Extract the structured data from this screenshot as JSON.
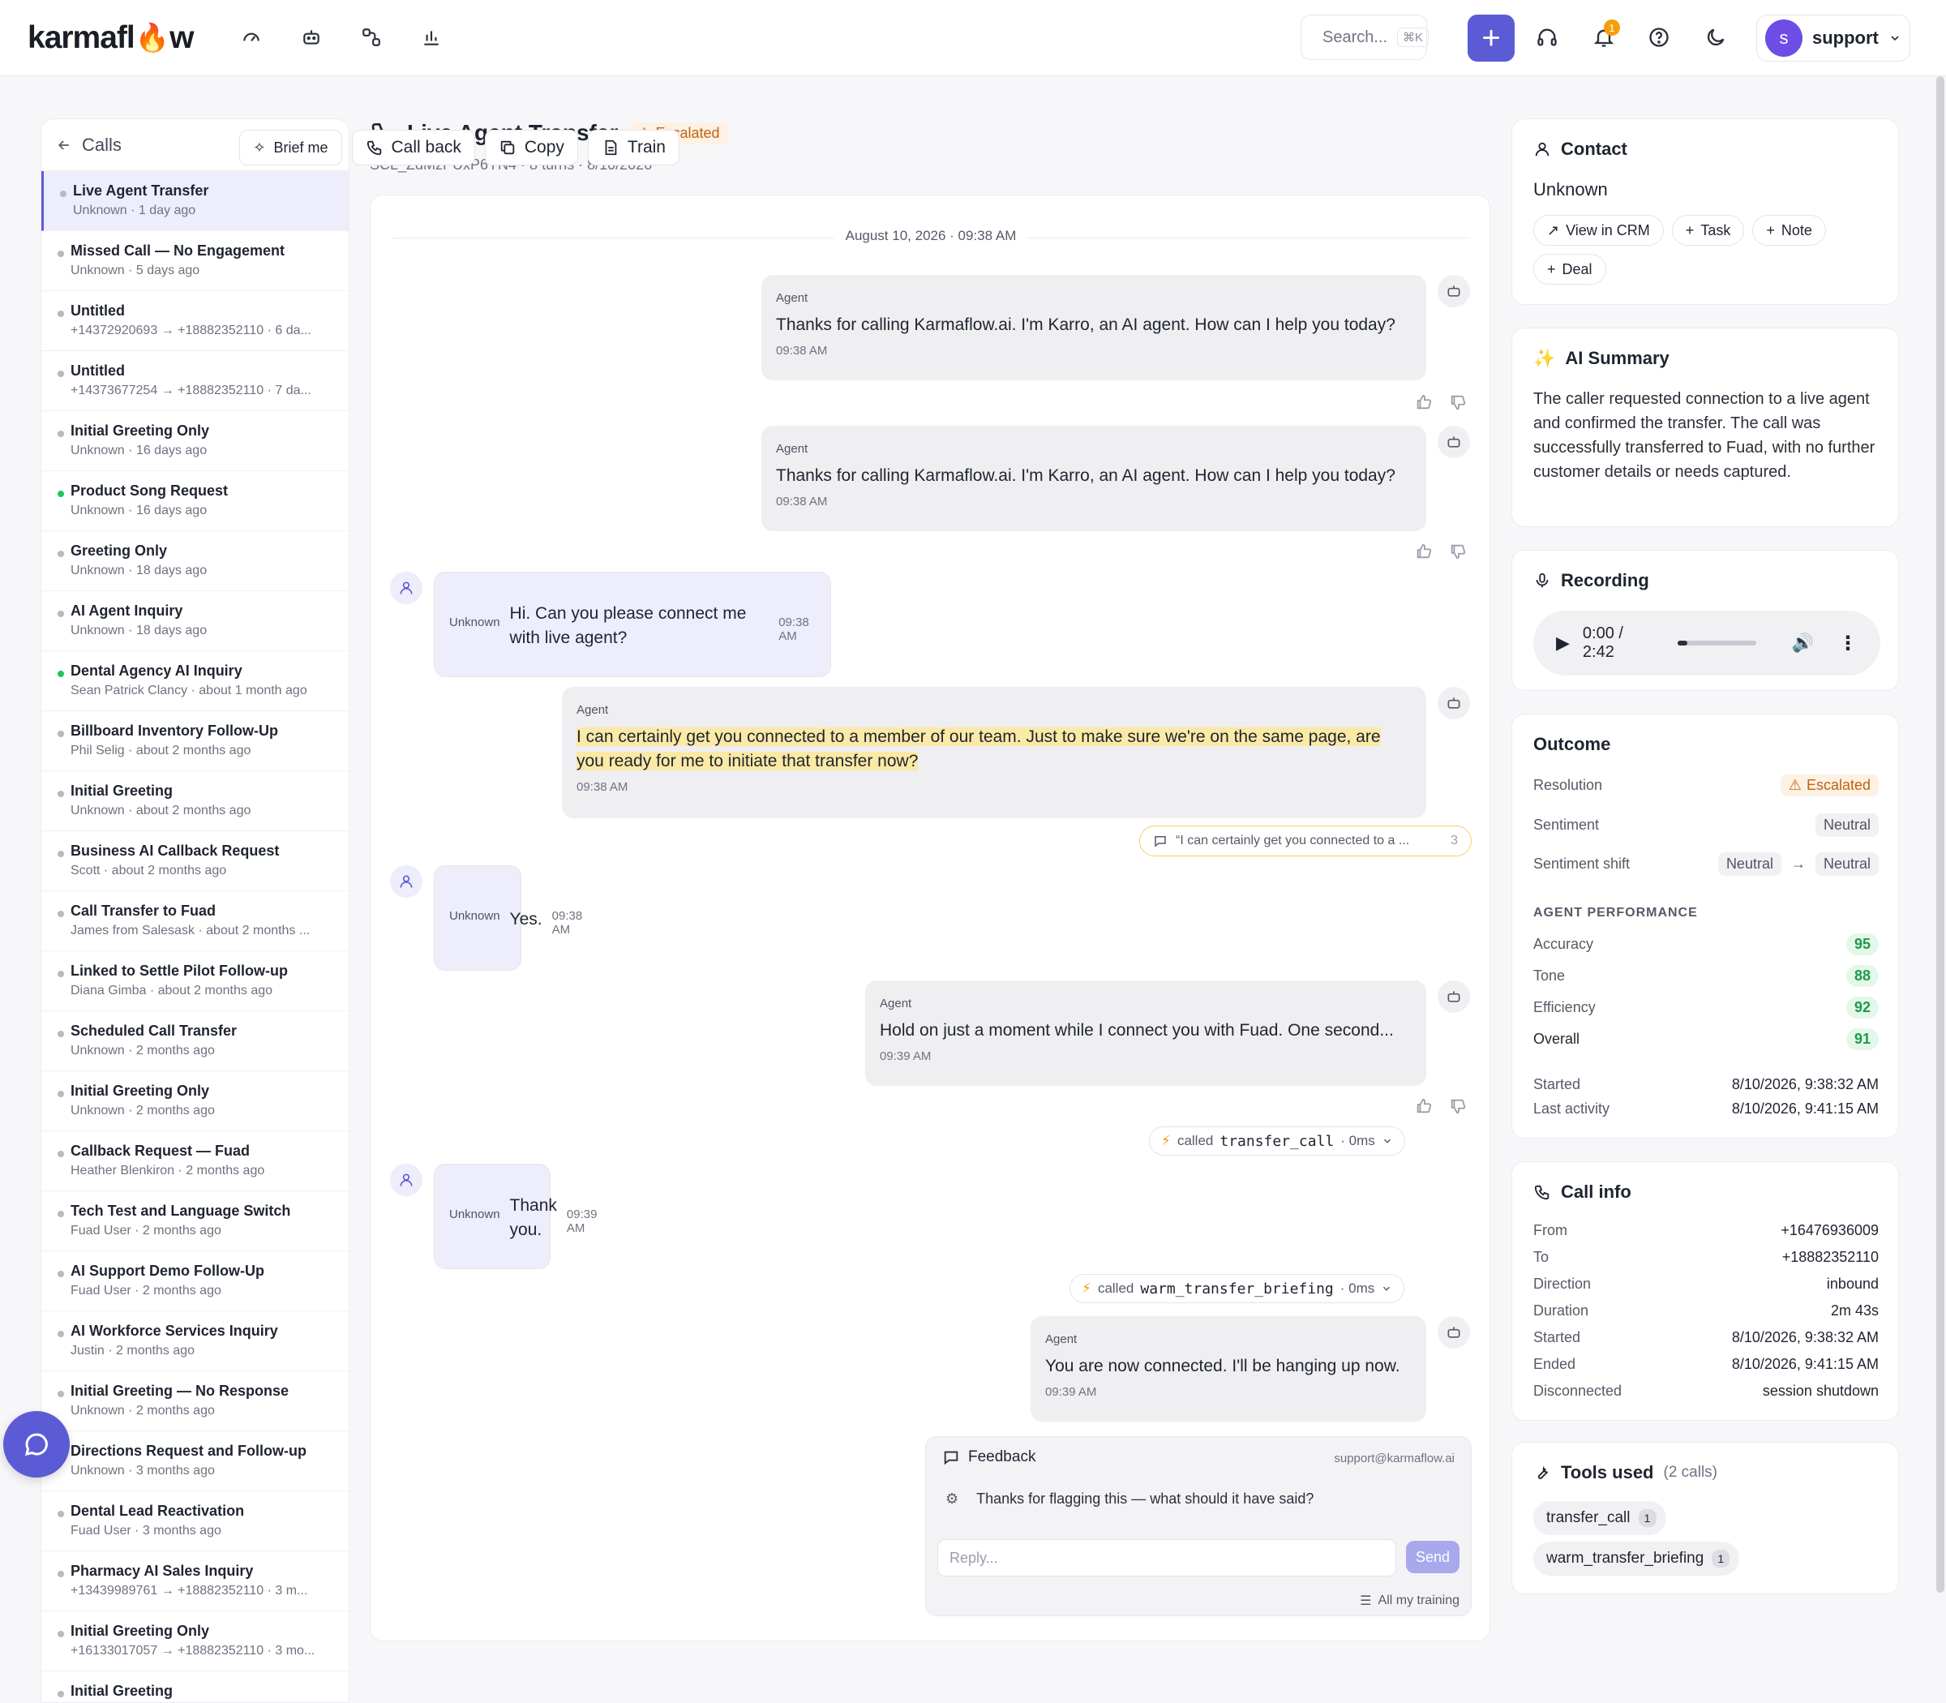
{
  "brand": {
    "logo_a": "karmafl",
    "logo_b": "w"
  },
  "topbar": {
    "nav_icons": [
      "gauge-icon",
      "bot-icon",
      "workflow-icon",
      "bar-chart-icon"
    ],
    "search_placeholder": "Search...",
    "search_kbd": "⌘K",
    "notifications_count": "1",
    "user_initial": "s",
    "user_name": "support"
  },
  "sidebar": {
    "title": "Calls",
    "items": [
      {
        "title": "Live Agent Transfer",
        "sub": "Unknown · 1 day ago",
        "dot": "gray",
        "active": true
      },
      {
        "title": "Missed Call — No Engagement",
        "sub": "Unknown · 5 days ago",
        "dot": "gray"
      },
      {
        "title": "Untitled",
        "sub": "+14372920693 → +18882352110 · 6 da...",
        "dot": "gray"
      },
      {
        "title": "Untitled",
        "sub": "+14373677254 → +18882352110 · 7 da...",
        "dot": "gray"
      },
      {
        "title": "Initial Greeting Only",
        "sub": "Unknown · 16 days ago",
        "dot": "gray"
      },
      {
        "title": "Product Song Request",
        "sub": "Unknown · 16 days ago",
        "dot": "green"
      },
      {
        "title": "Greeting Only",
        "sub": "Unknown · 18 days ago",
        "dot": "gray"
      },
      {
        "title": "AI Agent Inquiry",
        "sub": "Unknown · 18 days ago",
        "dot": "gray"
      },
      {
        "title": "Dental Agency AI Inquiry",
        "sub": "Sean Patrick Clancy · about 1 month ago",
        "dot": "green"
      },
      {
        "title": "Billboard Inventory Follow-Up",
        "sub": "Phil Selig · about 2 months ago",
        "dot": "gray"
      },
      {
        "title": "Initial Greeting",
        "sub": "Unknown · about 2 months ago",
        "dot": "gray"
      },
      {
        "title": "Business AI Callback Request",
        "sub": "Scott · about 2 months ago",
        "dot": "gray"
      },
      {
        "title": "Call Transfer to Fuad",
        "sub": "James from Salesask · about 2 months ...",
        "dot": "gray"
      },
      {
        "title": "Linked to Settle Pilot Follow-up",
        "sub": "Diana Gimba · about 2 months ago",
        "dot": "gray"
      },
      {
        "title": "Scheduled Call Transfer",
        "sub": "Unknown · 2 months ago",
        "dot": "gray"
      },
      {
        "title": "Initial Greeting Only",
        "sub": "Unknown · 2 months ago",
        "dot": "gray"
      },
      {
        "title": "Callback Request — Fuad",
        "sub": "Heather Blenkiron · 2 months ago",
        "dot": "gray"
      },
      {
        "title": "Tech Test and Language Switch",
        "sub": "Fuad User · 2 months ago",
        "dot": "gray"
      },
      {
        "title": "AI Support Demo Follow-Up",
        "sub": "Fuad User · 2 months ago",
        "dot": "gray"
      },
      {
        "title": "AI Workforce Services Inquiry",
        "sub": "Justin · 2 months ago",
        "dot": "gray"
      },
      {
        "title": "Initial Greeting — No Response",
        "sub": "Unknown · 2 months ago",
        "dot": "gray"
      },
      {
        "title": "Directions Request and Follow-up",
        "sub": "Unknown · 3 months ago",
        "dot": "gray"
      },
      {
        "title": "Dental Lead Reactivation",
        "sub": "Fuad User · 3 months ago",
        "dot": "gray"
      },
      {
        "title": "Pharmacy AI Sales Inquiry",
        "sub": "+13439989761 → +18882352110 · 3 m...",
        "dot": "gray"
      },
      {
        "title": "Initial Greeting Only",
        "sub": "+16133017057 → +18882352110 · 3 mo...",
        "dot": "gray"
      },
      {
        "title": "Initial Greeting",
        "sub": "",
        "dot": "gray"
      }
    ]
  },
  "call": {
    "title": "Live Agent Transfer",
    "status": "Escalated",
    "meta": "SCL_ZdMzPUxP6YN4 · 8 turns · 8/10/2026",
    "actions": {
      "brief": "Brief me",
      "callback": "Call back",
      "copy": "Copy",
      "train": "Train"
    }
  },
  "transcript": {
    "date": "August 10, 2026 · 09:38 AM",
    "messages": [
      {
        "who": "Agent",
        "text": "Thanks for calling Karmaflow.ai. I'm Karro, an AI agent. How can I help you today?",
        "time": "09:38 AM"
      },
      {
        "who": "Agent",
        "text": "Thanks for calling Karmaflow.ai. I'm Karro, an AI agent. How can I help you today?",
        "time": "09:38 AM"
      },
      {
        "who": "Unknown",
        "text": "Hi. Can you please connect me with live agent?",
        "time": "09:38 AM"
      },
      {
        "who": "Agent",
        "text": "I can certainly get you connected to a member of our team. Just to make sure we're on the same page, are you ready for me to initiate that transfer now?",
        "time": "09:38 AM"
      },
      {
        "who": "Unknown",
        "text": "Yes.",
        "time": "09:38 AM"
      },
      {
        "who": "Agent",
        "text": "Hold on just a moment while I connect you with Fuad. One second...",
        "time": "09:39 AM"
      },
      {
        "who": "Unknown",
        "text": "Thank you.",
        "time": "09:39 AM"
      },
      {
        "who": "Agent",
        "text": "You are now connected. I'll be hanging up now.",
        "time": "09:39 AM"
      }
    ],
    "quote": "“I can certainly get you connected to a ...",
    "quote_count": "3",
    "tool1": {
      "prefix": "called",
      "name": "transfer_call",
      "dur": "· 0ms"
    },
    "tool2": {
      "prefix": "called",
      "name": "warm_transfer_briefing",
      "dur": "· 0ms"
    },
    "feedback": {
      "title": "Feedback",
      "email": "support@karmaflow.ai",
      "question": "Thanks for flagging this — what should it have said?",
      "reply_placeholder": "Reply...",
      "send": "Send",
      "all_training": "All my training"
    }
  },
  "contact": {
    "title": "Contact",
    "name": "Unknown",
    "chips": [
      "View in CRM",
      "Task",
      "Note",
      "Deal"
    ]
  },
  "summary": {
    "title": "AI Summary",
    "text": "The caller requested connection to a live agent and confirmed the transfer. The call was successfully transferred to Fuad, with no further customer details or needs captured."
  },
  "recording": {
    "title": "Recording",
    "time": "0:00 / 2:42",
    "progress": 0.0
  },
  "outcome": {
    "title": "Outcome",
    "resolution_label": "Resolution",
    "resolution": "Escalated",
    "sentiment_label": "Sentiment",
    "sentiment": "Neutral",
    "shift_label": "Sentiment shift",
    "shift_from": "Neutral",
    "shift_to": "Neutral",
    "perf_title": "AGENT PERFORMANCE",
    "accuracy_label": "Accuracy",
    "accuracy": "95",
    "tone_label": "Tone",
    "tone": "88",
    "efficiency_label": "Efficiency",
    "efficiency": "92",
    "overall_label": "Overall",
    "overall": "91",
    "started_label": "Started",
    "started": "8/10/2026, 9:38:32 AM",
    "last_label": "Last activity",
    "last": "8/10/2026, 9:41:15 AM"
  },
  "callinfo": {
    "title": "Call info",
    "rows": [
      {
        "k": "From",
        "v": "+16476936009"
      },
      {
        "k": "To",
        "v": "+18882352110"
      },
      {
        "k": "Direction",
        "v": "inbound"
      },
      {
        "k": "Duration",
        "v": "2m 43s"
      },
      {
        "k": "Started",
        "v": "8/10/2026, 9:38:32 AM"
      },
      {
        "k": "Ended",
        "v": "8/10/2026, 9:41:15 AM"
      },
      {
        "k": "Disconnected",
        "v": "session shutdown"
      }
    ]
  },
  "tools": {
    "title": "Tools used",
    "count": "(2 calls)",
    "items": [
      {
        "name": "transfer_call",
        "n": "1"
      },
      {
        "name": "warm_transfer_briefing",
        "n": "1"
      }
    ]
  },
  "colors": {
    "accent": "#5b5bd6",
    "escalated": "#c2620e",
    "score": "#1f9a4b"
  }
}
